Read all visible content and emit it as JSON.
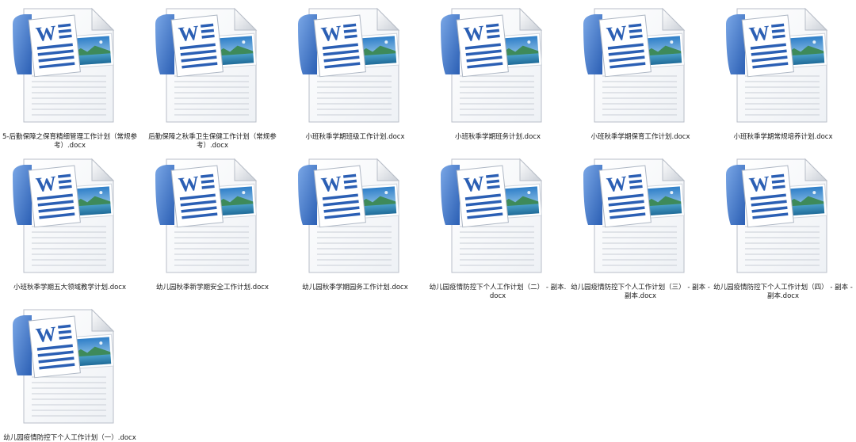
{
  "files": [
    {
      "name": "5-后勤保障之保育精细管理工作计划（常规参考）.docx",
      "icon": "word-document-icon"
    },
    {
      "name": "后勤保障之秋季卫生保健工作计划（常规参考）.docx",
      "icon": "word-document-icon"
    },
    {
      "name": "小班秋季学期班级工作计划.docx",
      "icon": "word-document-icon"
    },
    {
      "name": "小班秋季学期班务计划.docx",
      "icon": "word-document-icon"
    },
    {
      "name": "小班秋季学期保育工作计划.docx",
      "icon": "word-document-icon"
    },
    {
      "name": "小班秋季学期常规培养计划.docx",
      "icon": "word-document-icon"
    },
    {
      "name": "小班秋季学期五大领域教学计划.docx",
      "icon": "word-document-icon"
    },
    {
      "name": "幼儿园秋季新学期安全工作计划.docx",
      "icon": "word-document-icon"
    },
    {
      "name": "幼儿园秋季学期园务工作计划.docx",
      "icon": "word-document-icon"
    },
    {
      "name": "幼儿园疫情防控下个人工作计划（二） - 副本.docx",
      "icon": "word-document-icon"
    },
    {
      "name": "幼儿园疫情防控下个人工作计划（三） - 副本 - 副本.docx",
      "icon": "word-document-icon"
    },
    {
      "name": "幼儿园疫情防控下个人工作计划（四） - 副本 - 副本.docx",
      "icon": "word-document-icon"
    },
    {
      "name": "幼儿园疫情防控下个人工作计划（一）.docx",
      "icon": "word-document-icon"
    }
  ],
  "colors": {
    "page_background": "#ffffff",
    "label_text": "#1a1a1a",
    "word_blue": "#2b5fb4"
  }
}
